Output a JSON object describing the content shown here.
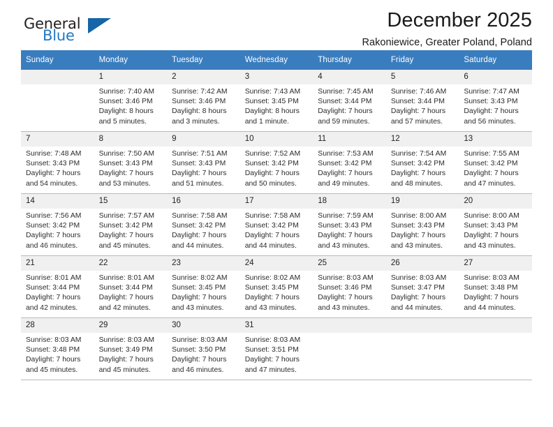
{
  "brand": {
    "name_top": "General",
    "name_bottom": "Blue",
    "triangle_color": "#1565a8",
    "blue_color": "#1f7ac4"
  },
  "header": {
    "month_title": "December 2025",
    "location": "Rakoniewice, Greater Poland, Poland"
  },
  "theme": {
    "header_bg": "#3a7dbf",
    "header_text": "#ffffff",
    "daynum_bg": "#f0f0f0",
    "row_border": "#b9b9b9"
  },
  "weekday_headers": [
    "Sunday",
    "Monday",
    "Tuesday",
    "Wednesday",
    "Thursday",
    "Friday",
    "Saturday"
  ],
  "weeks": [
    [
      {
        "day": "",
        "sunrise": "",
        "sunset": "",
        "daylight_1": "",
        "daylight_2": ""
      },
      {
        "day": "1",
        "sunrise": "Sunrise: 7:40 AM",
        "sunset": "Sunset: 3:46 PM",
        "daylight_1": "Daylight: 8 hours",
        "daylight_2": "and 5 minutes."
      },
      {
        "day": "2",
        "sunrise": "Sunrise: 7:42 AM",
        "sunset": "Sunset: 3:46 PM",
        "daylight_1": "Daylight: 8 hours",
        "daylight_2": "and 3 minutes."
      },
      {
        "day": "3",
        "sunrise": "Sunrise: 7:43 AM",
        "sunset": "Sunset: 3:45 PM",
        "daylight_1": "Daylight: 8 hours",
        "daylight_2": "and 1 minute."
      },
      {
        "day": "4",
        "sunrise": "Sunrise: 7:45 AM",
        "sunset": "Sunset: 3:44 PM",
        "daylight_1": "Daylight: 7 hours",
        "daylight_2": "and 59 minutes."
      },
      {
        "day": "5",
        "sunrise": "Sunrise: 7:46 AM",
        "sunset": "Sunset: 3:44 PM",
        "daylight_1": "Daylight: 7 hours",
        "daylight_2": "and 57 minutes."
      },
      {
        "day": "6",
        "sunrise": "Sunrise: 7:47 AM",
        "sunset": "Sunset: 3:43 PM",
        "daylight_1": "Daylight: 7 hours",
        "daylight_2": "and 56 minutes."
      }
    ],
    [
      {
        "day": "7",
        "sunrise": "Sunrise: 7:48 AM",
        "sunset": "Sunset: 3:43 PM",
        "daylight_1": "Daylight: 7 hours",
        "daylight_2": "and 54 minutes."
      },
      {
        "day": "8",
        "sunrise": "Sunrise: 7:50 AM",
        "sunset": "Sunset: 3:43 PM",
        "daylight_1": "Daylight: 7 hours",
        "daylight_2": "and 53 minutes."
      },
      {
        "day": "9",
        "sunrise": "Sunrise: 7:51 AM",
        "sunset": "Sunset: 3:43 PM",
        "daylight_1": "Daylight: 7 hours",
        "daylight_2": "and 51 minutes."
      },
      {
        "day": "10",
        "sunrise": "Sunrise: 7:52 AM",
        "sunset": "Sunset: 3:42 PM",
        "daylight_1": "Daylight: 7 hours",
        "daylight_2": "and 50 minutes."
      },
      {
        "day": "11",
        "sunrise": "Sunrise: 7:53 AM",
        "sunset": "Sunset: 3:42 PM",
        "daylight_1": "Daylight: 7 hours",
        "daylight_2": "and 49 minutes."
      },
      {
        "day": "12",
        "sunrise": "Sunrise: 7:54 AM",
        "sunset": "Sunset: 3:42 PM",
        "daylight_1": "Daylight: 7 hours",
        "daylight_2": "and 48 minutes."
      },
      {
        "day": "13",
        "sunrise": "Sunrise: 7:55 AM",
        "sunset": "Sunset: 3:42 PM",
        "daylight_1": "Daylight: 7 hours",
        "daylight_2": "and 47 minutes."
      }
    ],
    [
      {
        "day": "14",
        "sunrise": "Sunrise: 7:56 AM",
        "sunset": "Sunset: 3:42 PM",
        "daylight_1": "Daylight: 7 hours",
        "daylight_2": "and 46 minutes."
      },
      {
        "day": "15",
        "sunrise": "Sunrise: 7:57 AM",
        "sunset": "Sunset: 3:42 PM",
        "daylight_1": "Daylight: 7 hours",
        "daylight_2": "and 45 minutes."
      },
      {
        "day": "16",
        "sunrise": "Sunrise: 7:58 AM",
        "sunset": "Sunset: 3:42 PM",
        "daylight_1": "Daylight: 7 hours",
        "daylight_2": "and 44 minutes."
      },
      {
        "day": "17",
        "sunrise": "Sunrise: 7:58 AM",
        "sunset": "Sunset: 3:42 PM",
        "daylight_1": "Daylight: 7 hours",
        "daylight_2": "and 44 minutes."
      },
      {
        "day": "18",
        "sunrise": "Sunrise: 7:59 AM",
        "sunset": "Sunset: 3:43 PM",
        "daylight_1": "Daylight: 7 hours",
        "daylight_2": "and 43 minutes."
      },
      {
        "day": "19",
        "sunrise": "Sunrise: 8:00 AM",
        "sunset": "Sunset: 3:43 PM",
        "daylight_1": "Daylight: 7 hours",
        "daylight_2": "and 43 minutes."
      },
      {
        "day": "20",
        "sunrise": "Sunrise: 8:00 AM",
        "sunset": "Sunset: 3:43 PM",
        "daylight_1": "Daylight: 7 hours",
        "daylight_2": "and 43 minutes."
      }
    ],
    [
      {
        "day": "21",
        "sunrise": "Sunrise: 8:01 AM",
        "sunset": "Sunset: 3:44 PM",
        "daylight_1": "Daylight: 7 hours",
        "daylight_2": "and 42 minutes."
      },
      {
        "day": "22",
        "sunrise": "Sunrise: 8:01 AM",
        "sunset": "Sunset: 3:44 PM",
        "daylight_1": "Daylight: 7 hours",
        "daylight_2": "and 42 minutes."
      },
      {
        "day": "23",
        "sunrise": "Sunrise: 8:02 AM",
        "sunset": "Sunset: 3:45 PM",
        "daylight_1": "Daylight: 7 hours",
        "daylight_2": "and 43 minutes."
      },
      {
        "day": "24",
        "sunrise": "Sunrise: 8:02 AM",
        "sunset": "Sunset: 3:45 PM",
        "daylight_1": "Daylight: 7 hours",
        "daylight_2": "and 43 minutes."
      },
      {
        "day": "25",
        "sunrise": "Sunrise: 8:03 AM",
        "sunset": "Sunset: 3:46 PM",
        "daylight_1": "Daylight: 7 hours",
        "daylight_2": "and 43 minutes."
      },
      {
        "day": "26",
        "sunrise": "Sunrise: 8:03 AM",
        "sunset": "Sunset: 3:47 PM",
        "daylight_1": "Daylight: 7 hours",
        "daylight_2": "and 44 minutes."
      },
      {
        "day": "27",
        "sunrise": "Sunrise: 8:03 AM",
        "sunset": "Sunset: 3:48 PM",
        "daylight_1": "Daylight: 7 hours",
        "daylight_2": "and 44 minutes."
      }
    ],
    [
      {
        "day": "28",
        "sunrise": "Sunrise: 8:03 AM",
        "sunset": "Sunset: 3:48 PM",
        "daylight_1": "Daylight: 7 hours",
        "daylight_2": "and 45 minutes."
      },
      {
        "day": "29",
        "sunrise": "Sunrise: 8:03 AM",
        "sunset": "Sunset: 3:49 PM",
        "daylight_1": "Daylight: 7 hours",
        "daylight_2": "and 45 minutes."
      },
      {
        "day": "30",
        "sunrise": "Sunrise: 8:03 AM",
        "sunset": "Sunset: 3:50 PM",
        "daylight_1": "Daylight: 7 hours",
        "daylight_2": "and 46 minutes."
      },
      {
        "day": "31",
        "sunrise": "Sunrise: 8:03 AM",
        "sunset": "Sunset: 3:51 PM",
        "daylight_1": "Daylight: 7 hours",
        "daylight_2": "and 47 minutes."
      },
      {
        "day": "",
        "sunrise": "",
        "sunset": "",
        "daylight_1": "",
        "daylight_2": ""
      },
      {
        "day": "",
        "sunrise": "",
        "sunset": "",
        "daylight_1": "",
        "daylight_2": ""
      },
      {
        "day": "",
        "sunrise": "",
        "sunset": "",
        "daylight_1": "",
        "daylight_2": ""
      }
    ]
  ]
}
